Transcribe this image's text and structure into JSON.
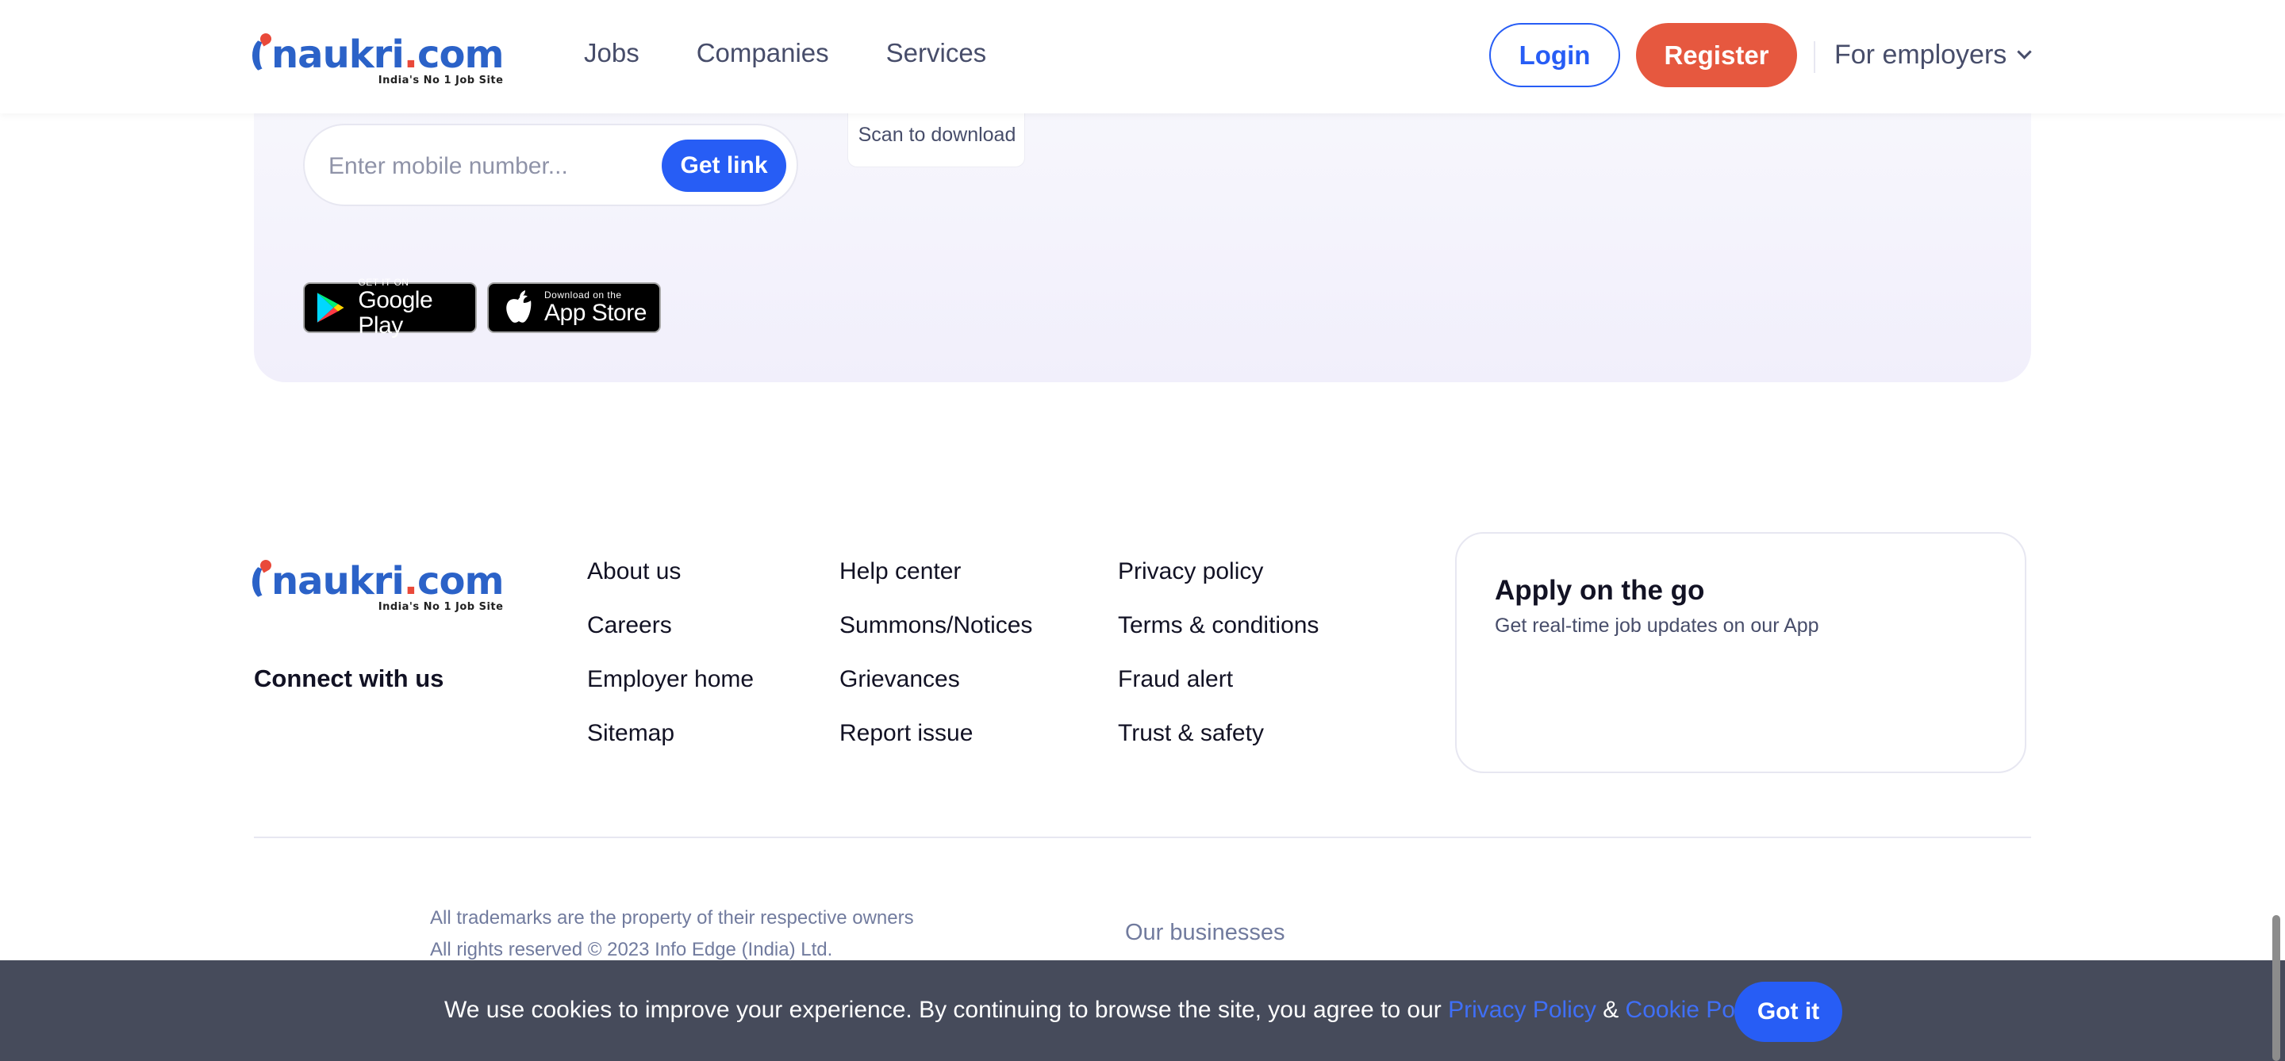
{
  "header": {
    "logo": {
      "brand_main": "naukri",
      "brand_dot": ".",
      "brand_suffix": "com",
      "tagline": "India's No 1 Job Site"
    },
    "nav": [
      "Jobs",
      "Companies",
      "Services"
    ],
    "login_label": "Login",
    "register_label": "Register",
    "for_employers_label": "For employers"
  },
  "app_banner": {
    "mobile_placeholder": "Enter mobile number...",
    "get_link_label": "Get link",
    "scan_label": "Scan to download",
    "google_play": {
      "small": "GET IT ON",
      "big": "Google Play"
    },
    "app_store": {
      "small": "Download on the",
      "big": "App Store"
    }
  },
  "footer": {
    "logo": {
      "brand_main": "naukri",
      "brand_dot": ".",
      "brand_suffix": "com",
      "tagline": "India's No 1 Job Site"
    },
    "connect_label": "Connect with us",
    "columns": [
      [
        "About us",
        "Careers",
        "Employer home",
        "Sitemap"
      ],
      [
        "Help center",
        "Summons/Notices",
        "Grievances",
        "Report issue"
      ],
      [
        "Privacy policy",
        "Terms & conditions",
        "Fraud alert",
        "Trust & safety"
      ]
    ],
    "apply_card": {
      "title": "Apply on the go",
      "subtitle": "Get real-time job updates on our App"
    },
    "trademark_text": "All trademarks are the property of their respective owners",
    "rights_text": "All rights reserved © 2023 Info Edge (India) Ltd.",
    "our_businesses_label": "Our businesses"
  },
  "cookie_bar": {
    "text": "We use cookies to improve your experience. By continuing to browse the site, you agree to our ",
    "privacy_link": "Privacy Policy",
    "ampersand": " & ",
    "cookie_link": "Cookie Policy",
    "got_it_label": "Got it"
  },
  "colors": {
    "brand_blue": "#275df5",
    "brand_red": "#e6583f",
    "text_dark": "#121224",
    "text_muted": "#717b9e",
    "banner_bg": "#f1effb",
    "cookie_bg": "#464b5b"
  },
  "icons": [
    "chevron-down-icon",
    "google-play-icon",
    "apple-icon"
  ]
}
